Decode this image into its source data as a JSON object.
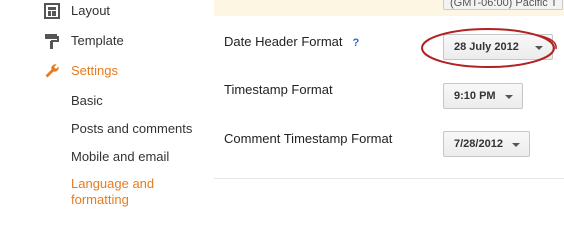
{
  "sidebar": {
    "layout_label": "Layout",
    "template_label": "Template",
    "settings_label": "Settings",
    "sub_items": [
      "Basic",
      "Posts and comments",
      "Mobile and email"
    ],
    "active_item_line1": "Language and",
    "active_item_line2": "formatting"
  },
  "main": {
    "top_select_partial": "(GMT-06:00) Pacific T",
    "date_header": {
      "label": "Date Header Format",
      "help": "?",
      "value": "28 July 2012"
    },
    "timestamp": {
      "label": "Timestamp Format",
      "value": "9:10 PM"
    },
    "comment_timestamp": {
      "label": "Comment Timestamp Format",
      "value": "7/28/2012"
    }
  },
  "colors": {
    "accent": "#e77c1f",
    "annotation": "#b22222",
    "help": "#3366cc"
  }
}
